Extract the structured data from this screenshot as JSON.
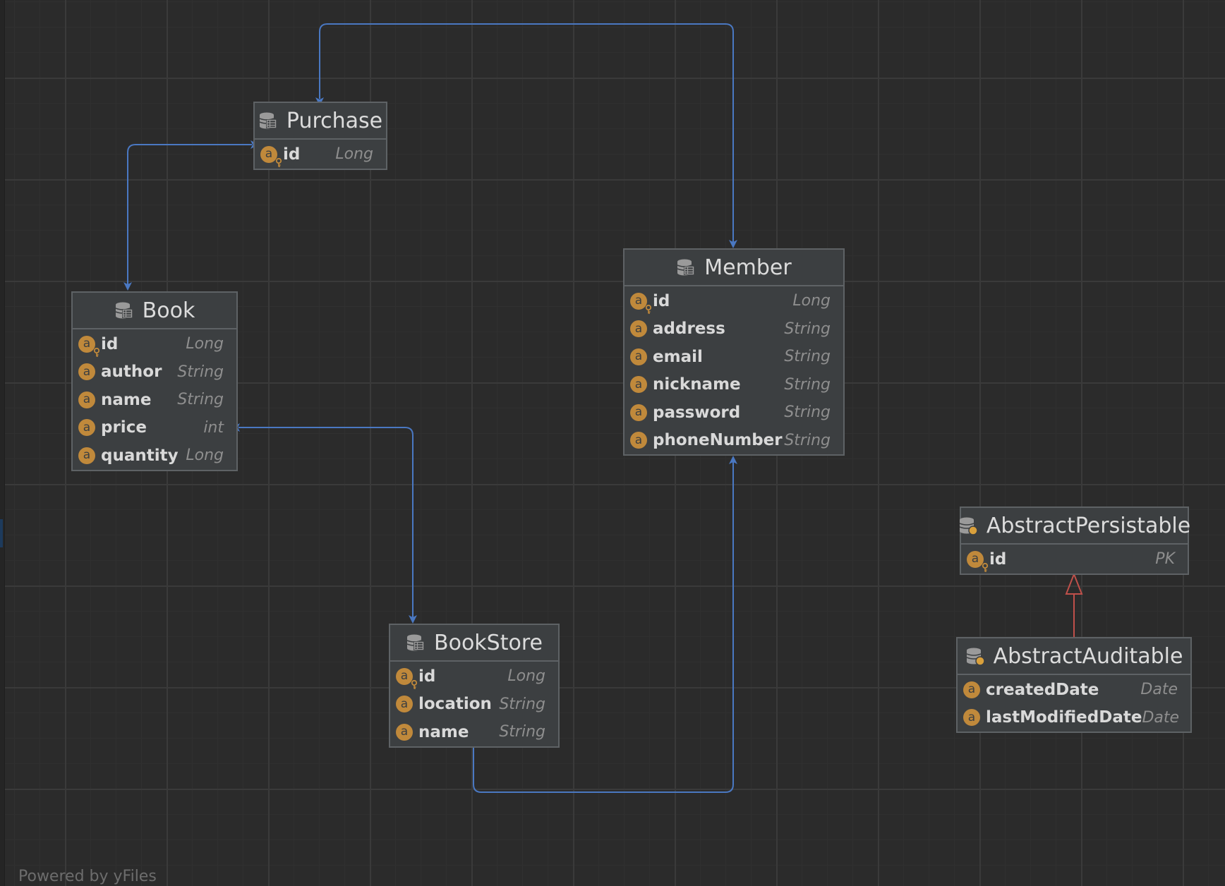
{
  "diagram": {
    "entities": {
      "purchase": {
        "name": "Purchase",
        "icon": "database-table-icon",
        "fields": [
          {
            "name": "id",
            "type": "Long",
            "pk": true
          }
        ]
      },
      "member": {
        "name": "Member",
        "icon": "database-table-icon",
        "fields": [
          {
            "name": "id",
            "type": "Long",
            "pk": true
          },
          {
            "name": "address",
            "type": "String",
            "pk": false
          },
          {
            "name": "email",
            "type": "String",
            "pk": false
          },
          {
            "name": "nickname",
            "type": "String",
            "pk": false
          },
          {
            "name": "password",
            "type": "String",
            "pk": false
          },
          {
            "name": "phoneNumber",
            "type": "String",
            "pk": false
          }
        ]
      },
      "book": {
        "name": "Book",
        "icon": "database-table-icon",
        "fields": [
          {
            "name": "id",
            "type": "Long",
            "pk": true
          },
          {
            "name": "author",
            "type": "String",
            "pk": false
          },
          {
            "name": "name",
            "type": "String",
            "pk": false
          },
          {
            "name": "price",
            "type": "int",
            "pk": false
          },
          {
            "name": "quantity",
            "type": "Long",
            "pk": false
          }
        ]
      },
      "bookstore": {
        "name": "BookStore",
        "icon": "database-table-icon",
        "fields": [
          {
            "name": "id",
            "type": "Long",
            "pk": true
          },
          {
            "name": "location",
            "type": "String",
            "pk": false
          },
          {
            "name": "name",
            "type": "String",
            "pk": false
          }
        ]
      },
      "abstract_persistable": {
        "name": "AbstractPersistable",
        "icon": "abstract-entity-icon",
        "fields": [
          {
            "name": "id",
            "type": "PK",
            "pk": true
          }
        ]
      },
      "abstract_auditable": {
        "name": "AbstractAuditable",
        "icon": "abstract-entity-icon",
        "fields": [
          {
            "name": "createdDate",
            "type": "Date",
            "pk": false
          },
          {
            "name": "lastModifiedDate",
            "type": "Date",
            "pk": false
          }
        ]
      }
    },
    "relations": [
      {
        "from": "Purchase",
        "to": "Member",
        "kind": "association"
      },
      {
        "from": "Purchase",
        "to": "Book",
        "kind": "association"
      },
      {
        "from": "Book",
        "to": "BookStore",
        "kind": "association"
      },
      {
        "from": "BookStore",
        "to": "Member",
        "kind": "association"
      },
      {
        "from": "AbstractAuditable",
        "to": "AbstractPersistable",
        "kind": "inheritance"
      }
    ],
    "badge_letter": "a",
    "colors": {
      "background": "#2b2b2b",
      "node_fill": "#3c3f41",
      "node_border": "#5e6265",
      "association_edge": "#4a78c2",
      "inheritance_edge": "#c0504a",
      "field_badge": "#c0893b"
    }
  },
  "footer": {
    "text": "Powered by yFiles"
  }
}
